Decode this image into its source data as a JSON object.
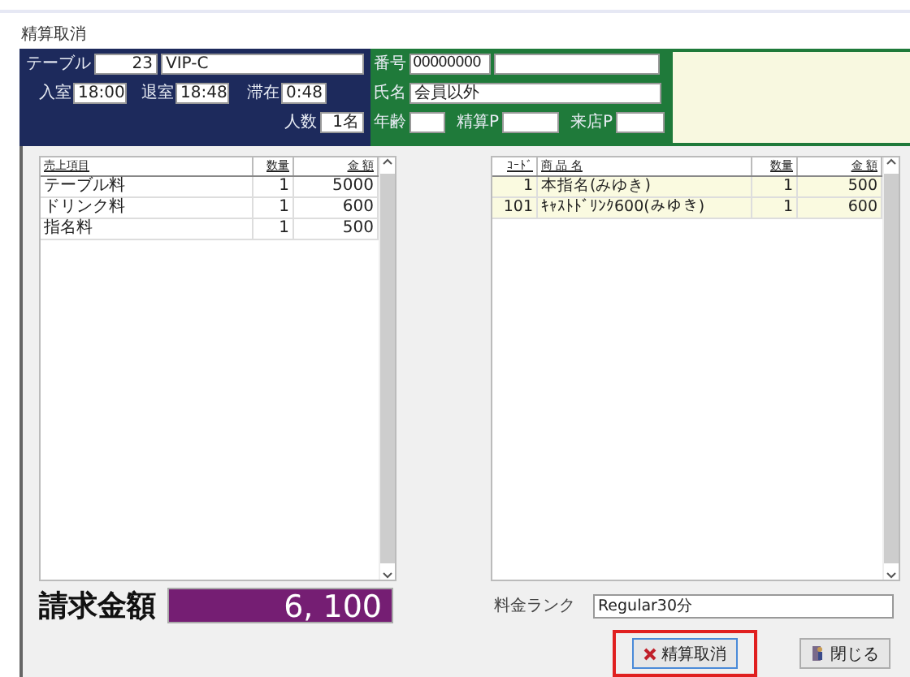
{
  "window": {
    "title": "精算取消"
  },
  "seat": {
    "table_label": "テーブル",
    "table_no": "23",
    "room": "VIP-C",
    "in_label": "入室",
    "in_time": "18:00",
    "out_label": "退室",
    "out_time": "18:48",
    "stay_label": "滞在",
    "stay": "0:48",
    "people_label": "人数",
    "people": "1名"
  },
  "member": {
    "number_label": "番号",
    "number": "00000000",
    "name_label": "氏名",
    "name": "会員以外",
    "age_label": "年齢",
    "settle_p_label": "精算P",
    "visit_p_label": "来店P"
  },
  "sales": {
    "columns": [
      "売上項目",
      "数量",
      "金 額"
    ],
    "rows": [
      [
        "テーブル料",
        "1",
        "5000"
      ],
      [
        "ドリンク料",
        "1",
        "600"
      ],
      [
        "指名料",
        "1",
        "500"
      ]
    ]
  },
  "items": {
    "columns": [
      "ｺｰﾄﾞ",
      "商 品 名",
      "数量",
      "金 額"
    ],
    "rows": [
      [
        "1",
        "本指名(みゆき)",
        "1",
        "500"
      ],
      [
        "101",
        "ｷｬｽﾄﾄﾞﾘﾝｸ600(みゆき)",
        "1",
        "600"
      ]
    ]
  },
  "total": {
    "label": "請求金額",
    "amount": "6, 100"
  },
  "rank": {
    "label": "料金ランク",
    "value": "Regular30分"
  },
  "buttons": [
    {
      "label": "精算取消",
      "kind": "cancel",
      "highlighted": true
    },
    {
      "label": "閉じる",
      "kind": "close",
      "highlighted": false
    }
  ]
}
